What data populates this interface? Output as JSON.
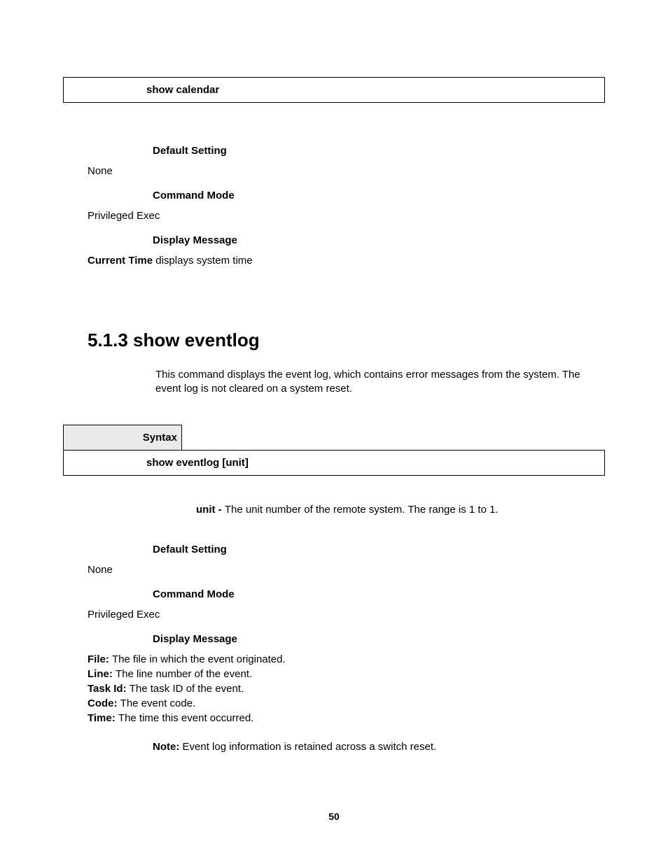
{
  "upper": {
    "command": "show calendar",
    "default_heading": "Default Setting",
    "default_value": "None",
    "mode_heading": "Command Mode",
    "mode_value": "Privileged Exec",
    "display_heading": "Display Message",
    "display_bold": "Current Time",
    "display_rest": " displays system time"
  },
  "section": {
    "title": "5.1.3 show eventlog",
    "description": "This command displays the event log, which contains error messages from the system. The event log is not cleared on a system reset."
  },
  "syntax": {
    "label": "Syntax",
    "command": "show eventlog [unit]"
  },
  "param": {
    "bold": "unit - ",
    "rest": "The unit number of the remote system. The range is 1 to 1."
  },
  "lower": {
    "default_heading": "Default Setting",
    "default_value": "None",
    "mode_heading": "Command Mode",
    "mode_value": "Privileged Exec",
    "display_heading": "Display Message",
    "lines": [
      {
        "bold": "File: ",
        "rest": "The file in which the event originated."
      },
      {
        "bold": "Line: ",
        "rest": "The line number of the event."
      },
      {
        "bold": "Task Id: ",
        "rest": "The task ID of the event."
      },
      {
        "bold": "Code: ",
        "rest": "The event code."
      },
      {
        "bold": "Time: ",
        "rest": "The time this event occurred."
      }
    ],
    "note_bold": "Note: ",
    "note_rest": "Event log information is retained across a switch reset."
  },
  "page_number": "50"
}
